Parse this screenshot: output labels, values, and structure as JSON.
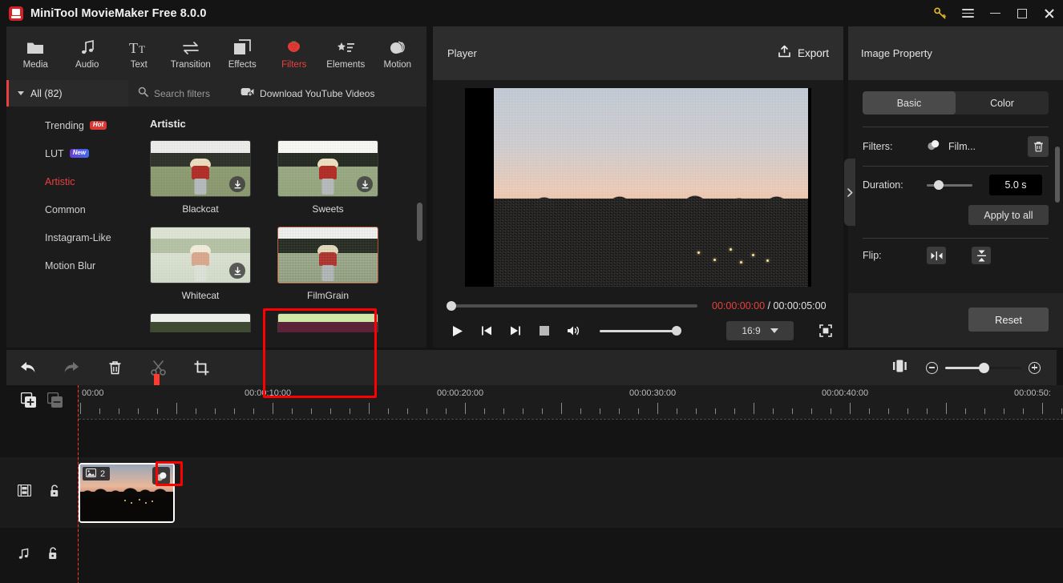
{
  "titlebar": {
    "app_title": "MiniTool MovieMaker Free 8.0.0",
    "logo_icon": "minitool-logo-icon",
    "key_icon": "key-icon",
    "menu_icon": "hamburger-menu-icon",
    "minimize_icon": "minimize-icon",
    "maximize_icon": "maximize-icon",
    "close_icon": "close-icon"
  },
  "ribbon": {
    "items": [
      {
        "label": "Media",
        "icon": "folder-icon",
        "active": false
      },
      {
        "label": "Audio",
        "icon": "music-note-icon",
        "active": false
      },
      {
        "label": "Text",
        "icon": "text-tt-icon",
        "active": false
      },
      {
        "label": "Transition",
        "icon": "transition-arrows-icon",
        "active": false
      },
      {
        "label": "Effects",
        "icon": "layers-icon",
        "active": false
      },
      {
        "label": "Filters",
        "icon": "strawberry-icon",
        "active": true
      },
      {
        "label": "Elements",
        "icon": "star-list-icon",
        "active": false
      },
      {
        "label": "Motion",
        "icon": "motion-sphere-icon",
        "active": false
      }
    ]
  },
  "categories": {
    "all_label": "All (82)",
    "items": [
      {
        "label": "Trending",
        "badge": "Hot",
        "badge_type": "hot",
        "active": false
      },
      {
        "label": "LUT",
        "badge": "New",
        "badge_type": "new",
        "active": false
      },
      {
        "label": "Artistic",
        "badge": "",
        "badge_type": "",
        "active": true
      },
      {
        "label": "Common",
        "badge": "",
        "badge_type": "",
        "active": false
      },
      {
        "label": "Instagram-Like",
        "badge": "",
        "badge_type": "",
        "active": false
      },
      {
        "label": "Motion Blur",
        "badge": "",
        "badge_type": "",
        "active": false
      }
    ]
  },
  "browser": {
    "search_placeholder": "Search filters",
    "search_icon": "search-icon",
    "youtube_label": "Download YouTube Videos",
    "youtube_icon": "youtube-download-icon",
    "group_title": "Artistic",
    "filters": [
      {
        "name": "Blackcat",
        "downloadable": true,
        "selected": false
      },
      {
        "name": "Sweets",
        "downloadable": true,
        "selected": false
      },
      {
        "name": "Whitecat",
        "downloadable": true,
        "selected": false
      },
      {
        "name": "FilmGrain",
        "downloadable": false,
        "selected": true
      }
    ]
  },
  "player": {
    "title": "Player",
    "export_label": "Export",
    "export_icon": "export-upload-icon",
    "current_time": "00:00:00:00",
    "time_separator": "/",
    "total_time": "00:00:05:00",
    "aspect_ratio": "16:9",
    "controls": {
      "play_icon": "play-icon",
      "prev_frame_icon": "previous-frame-icon",
      "next_frame_icon": "next-frame-icon",
      "stop_icon": "stop-icon",
      "volume_icon": "volume-icon",
      "fullscreen_icon": "fullscreen-icon"
    }
  },
  "property": {
    "title": "Image Property",
    "tabs": [
      {
        "label": "Basic",
        "active": true
      },
      {
        "label": "Color",
        "active": false
      }
    ],
    "filters_label": "Filters:",
    "filter_value": "Film...",
    "filter_icon": "filter-circles-icon",
    "delete_icon": "trash-icon",
    "duration_label": "Duration:",
    "duration_value": "5.0 s",
    "apply_all_label": "Apply to all",
    "flip_label": "Flip:",
    "flip_horizontal_icon": "flip-horizontal-icon",
    "flip_vertical_icon": "flip-vertical-icon",
    "reset_label": "Reset",
    "collapse_icon": "chevron-right-icon"
  },
  "timeline": {
    "tools": [
      {
        "icon": "undo-icon",
        "name": "undo"
      },
      {
        "icon": "redo-icon",
        "name": "redo"
      },
      {
        "icon": "delete-icon",
        "name": "delete"
      },
      {
        "icon": "split-scissors-icon",
        "name": "split"
      },
      {
        "icon": "crop-icon",
        "name": "crop"
      }
    ],
    "split_view_icon": "split-view-icon",
    "zoom_out_icon": "zoom-out-icon",
    "zoom_in_icon": "zoom-in-icon",
    "add_track_icon": "add-track-icon",
    "remove_track_icon": "remove-track-icon",
    "ruler_labels": [
      "00:00",
      "00:00:10:00",
      "00:00:20:00",
      "00:00:30:00",
      "00:00:40:00",
      "00:00:50:"
    ],
    "video_track_icon": "film-strip-icon",
    "video_lock_icon": "unlock-icon",
    "audio_track_icon": "music-note-icon",
    "audio_lock_icon": "unlock-icon",
    "clip": {
      "count_label": "2",
      "image_icon": "image-icon",
      "effect_icon": "filter-applied-icon"
    }
  },
  "colors": {
    "accent_red": "#e8413f",
    "highlight_red": "#ff0000",
    "playhead_red": "#ff3b30",
    "panel_bg": "#1c1c1c",
    "header_bg": "#2d2d2d",
    "key_yellow": "#e8b923"
  }
}
